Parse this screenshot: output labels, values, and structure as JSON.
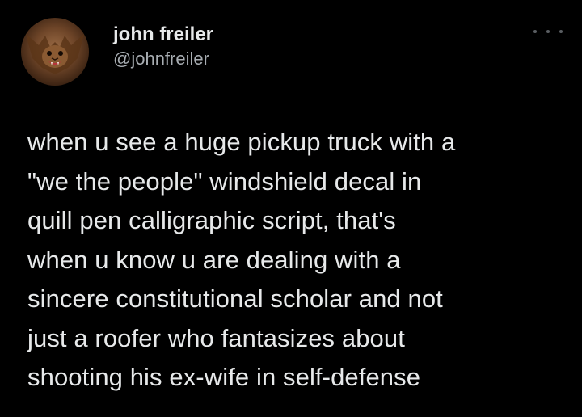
{
  "tweet": {
    "author": {
      "display_name": "john freiler",
      "handle": "@johnfreiler",
      "avatar_icon": "bat-avatar-icon"
    },
    "more_icon": "more-options-icon",
    "text_lines": [
      "when u see a huge pickup truck with a",
      "\"we the people\" windshield decal in",
      "quill pen calligraphic script, that's",
      "when u know u are dealing with a",
      "sincere constitutional scholar and not",
      "just a roofer who fantasizes about",
      "shooting his ex-wife in self-defense"
    ]
  },
  "colors": {
    "background": "#000000",
    "primary_text": "#e7e9ea",
    "secondary_text": "#a8adb2"
  }
}
